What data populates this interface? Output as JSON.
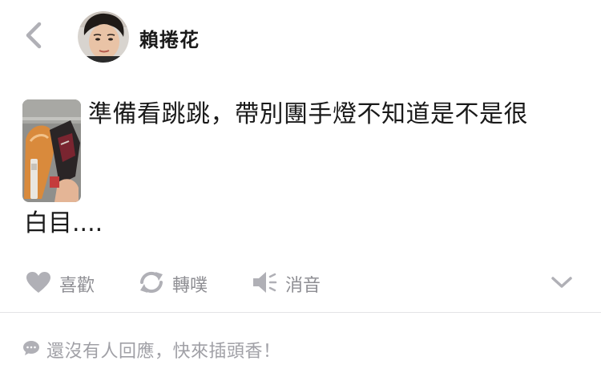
{
  "header": {
    "author_name": "賴捲花",
    "back_icon": "chevron-left-icon",
    "avatar_icon": "user-avatar"
  },
  "post": {
    "text_line_1": "準備看跳跳，帶別團手燈不知道是不是很",
    "text_line_2": "白目....",
    "image_icon": "photo-thumbnail"
  },
  "actions": {
    "like_label": "喜歡",
    "repost_label": "轉噗",
    "mute_label": "消音",
    "like_icon": "heart-icon",
    "repost_icon": "repost-icon",
    "mute_icon": "speaker-mute-icon",
    "more_icon": "chevron-down-icon"
  },
  "reply": {
    "prompt_text": "還沒有人回應，快來插頭香！",
    "icon": "speech-bubble-icon"
  },
  "colors": {
    "icon_gray": "#b0b0b6",
    "label_gray": "#8e8e93",
    "divider": "#e3e3e6",
    "text": "#1a1a1a"
  }
}
